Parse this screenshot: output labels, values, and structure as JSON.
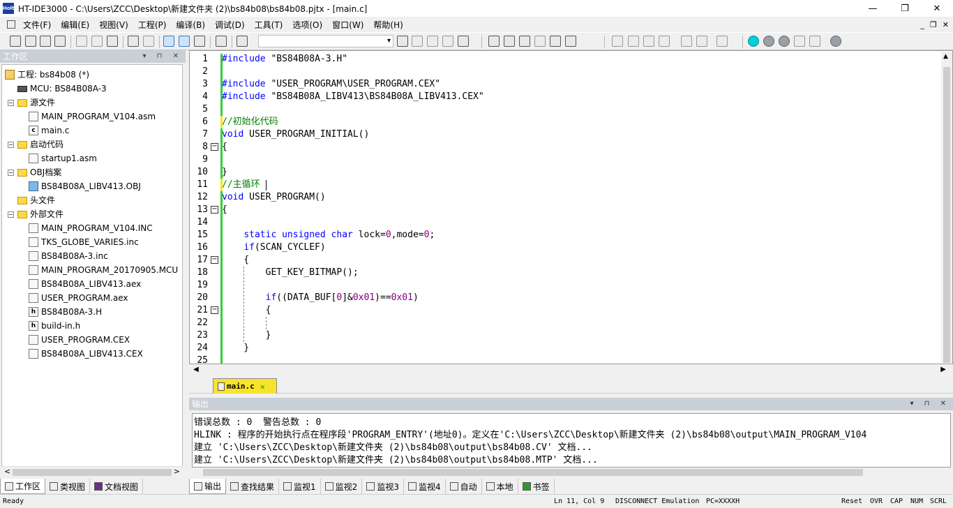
{
  "window": {
    "title": "HT-IDE3000 - C:\\Users\\ZCC\\Desktop\\新建文件夹 (2)\\bs84b08\\bs84b08.pjtx - [main.c]",
    "app_icon_text": "Holtek",
    "minimize": "—",
    "maximize": "❐",
    "close": "✕"
  },
  "menu": [
    "文件(F)",
    "编辑(E)",
    "视图(V)",
    "工程(P)",
    "编译(B)",
    "调试(D)",
    "工具(T)",
    "选项(O)",
    "窗口(W)",
    "帮助(H)"
  ],
  "doc_controls": {
    "minimize": "_",
    "restore": "❐",
    "close": "✕"
  },
  "workspace": {
    "header": "工作区",
    "header_controls": "▾ ⊓ ✕",
    "tree": [
      {
        "label": "工程: bs84b08 (*)",
        "indent": 0,
        "icon": "project-icon",
        "toggle": ""
      },
      {
        "label": "MCU: BS84B08A-3",
        "indent": 1,
        "icon": "chip-icon",
        "toggle": ""
      },
      {
        "label": "源文件",
        "indent": 1,
        "icon": "folder-icon",
        "toggle": "−"
      },
      {
        "label": "MAIN_PROGRAM_V104.asm",
        "indent": 2,
        "icon": "file-icon",
        "toggle": ""
      },
      {
        "label": "main.c",
        "indent": 2,
        "icon": "c-file-icon",
        "toggle": ""
      },
      {
        "label": "启动代码",
        "indent": 1,
        "icon": "folder-icon",
        "toggle": "−"
      },
      {
        "label": "startup1.asm",
        "indent": 2,
        "icon": "file-icon",
        "toggle": ""
      },
      {
        "label": "OBJ档案",
        "indent": 1,
        "icon": "folder-icon",
        "toggle": "−"
      },
      {
        "label": "BS84B08A_LIBV413.OBJ",
        "indent": 2,
        "icon": "obj-file-icon",
        "toggle": ""
      },
      {
        "label": "头文件",
        "indent": 1,
        "icon": "folder-icon",
        "toggle": ""
      },
      {
        "label": "外部文件",
        "indent": 1,
        "icon": "folder-icon",
        "toggle": "−"
      },
      {
        "label": "MAIN_PROGRAM_V104.INC",
        "indent": 2,
        "icon": "file-icon",
        "toggle": ""
      },
      {
        "label": "TKS_GLOBE_VARIES.inc",
        "indent": 2,
        "icon": "file-icon",
        "toggle": ""
      },
      {
        "label": "BS84B08A-3.inc",
        "indent": 2,
        "icon": "file-icon",
        "toggle": ""
      },
      {
        "label": "MAIN_PROGRAM_20170905.MCU",
        "indent": 2,
        "icon": "file-icon",
        "toggle": ""
      },
      {
        "label": "BS84B08A_LIBV413.aex",
        "indent": 2,
        "icon": "file-icon",
        "toggle": ""
      },
      {
        "label": "USER_PROGRAM.aex",
        "indent": 2,
        "icon": "file-icon",
        "toggle": ""
      },
      {
        "label": "BS84B08A-3.H",
        "indent": 2,
        "icon": "h-file-icon",
        "toggle": ""
      },
      {
        "label": "build-in.h",
        "indent": 2,
        "icon": "h-file-icon",
        "toggle": ""
      },
      {
        "label": "USER_PROGRAM.CEX",
        "indent": 2,
        "icon": "file-icon",
        "toggle": ""
      },
      {
        "label": "BS84B08A_LIBV413.CEX",
        "indent": 2,
        "icon": "file-icon",
        "toggle": ""
      }
    ],
    "tabs": [
      "工作区",
      "类视图",
      "文档视图"
    ],
    "scroll_left": "<",
    "scroll_right": ">"
  },
  "editor": {
    "file_tab": "main.c",
    "file_tab_close": "✕",
    "lines": [
      [
        [
          "pp",
          "#include \"BS84B08A-3.H\""
        ]
      ],
      [],
      [
        [
          "pp",
          "#include \"USER_PROGRAM\\USER_PROGRAM.CEX\""
        ]
      ],
      [
        [
          "pp",
          "#include \"BS84B08A_LIBV413\\BS84B08A_LIBV413.CEX\""
        ]
      ],
      [],
      [
        [
          "cm",
          "//初始化代码"
        ]
      ],
      [
        [
          "kw",
          "void"
        ],
        [
          "pl",
          " USER_PROGRAM_INITIAL()"
        ]
      ],
      [
        [
          "pl",
          "{"
        ]
      ],
      [],
      [
        [
          "pl",
          "}"
        ]
      ],
      [
        [
          "cm",
          "//主循环"
        ]
      ],
      [
        [
          "kw",
          "void"
        ],
        [
          "pl",
          " USER_PROGRAM()"
        ]
      ],
      [
        [
          "pl",
          "{"
        ]
      ],
      [],
      [
        [
          "pl",
          "    "
        ],
        [
          "kw",
          "static unsigned char"
        ],
        [
          "pl",
          " lock="
        ],
        [
          "nm",
          "0"
        ],
        [
          "pl",
          ",mode="
        ],
        [
          "nm",
          "0"
        ],
        [
          "pl",
          ";"
        ]
      ],
      [
        [
          "pl",
          "    "
        ],
        [
          "kw",
          "if"
        ],
        [
          "pl",
          "(SCAN_CYCLEF)"
        ]
      ],
      [
        [
          "pl",
          "    {"
        ]
      ],
      [
        [
          "pl",
          "        GET_KEY_BITMAP();"
        ]
      ],
      [],
      [
        [
          "pl",
          "        "
        ],
        [
          "kw",
          "if"
        ],
        [
          "pl",
          "((DATA_BUF["
        ],
        [
          "nm",
          "0"
        ],
        [
          "pl",
          "]&"
        ],
        [
          "nm",
          "0x01"
        ],
        [
          "pl",
          ")=="
        ],
        [
          "nm",
          "0x01"
        ],
        [
          "pl",
          ")"
        ]
      ],
      [
        [
          "pl",
          "        {"
        ]
      ],
      [],
      [
        [
          "pl",
          "        }"
        ]
      ],
      [
        [
          "pl",
          "    }"
        ]
      ],
      []
    ],
    "fold_lines": [
      8,
      13,
      17,
      21
    ],
    "cursor": "Ln 11, Col 9"
  },
  "output": {
    "header": "输出",
    "header_controls": "▾ ⊓ ✕",
    "lines": [
      "错误总数 : 0  警告总数 : 0",
      "HLINK : 程序的开始执行点在程序段'PROGRAM_ENTRY'(地址0)。定义在'C:\\Users\\ZCC\\Desktop\\新建文件夹 (2)\\bs84b08\\output\\MAIN_PROGRAM_V104",
      "建立 'C:\\Users\\ZCC\\Desktop\\新建文件夹 (2)\\bs84b08\\output\\bs84b08.CV' 文档...",
      "建立 'C:\\Users\\ZCC\\Desktop\\新建文件夹 (2)\\bs84b08\\output\\bs84b08.MTP' 文档..."
    ],
    "tabs": [
      "输出",
      "查找结果",
      "监视1",
      "监视2",
      "监视3",
      "监视4",
      "自动",
      "本地",
      "书签"
    ]
  },
  "status": {
    "ready": "Ready",
    "position": "Ln 11, Col 9",
    "emulation": "DISCONNECT Emulation",
    "pc": "PC=XXXXH",
    "reset": "Reset",
    "ovr": "OVR",
    "cap": "CAP",
    "num": "NUM",
    "scrl": "SCRL"
  }
}
